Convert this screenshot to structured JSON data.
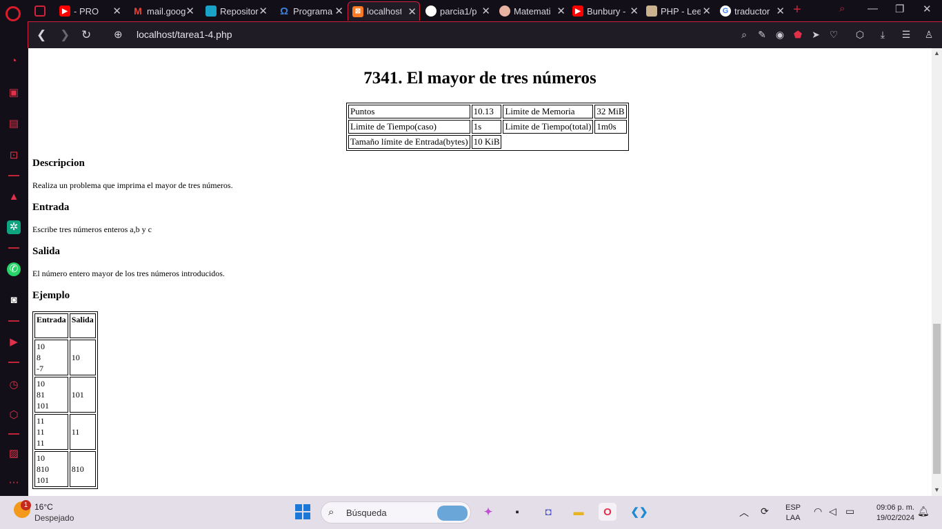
{
  "browser": {
    "tabs": [
      {
        "title": "",
        "icon": "gamepad-icon",
        "color": "#d3243c"
      },
      {
        "title": "- PRO",
        "icon": "youtube-icon",
        "color": "#ff0000"
      },
      {
        "title": "mail.goog",
        "icon": "gmail-icon",
        "color": "#ea4335"
      },
      {
        "title": "Repositor",
        "icon": "repository-icon",
        "color": "#1aa3c9"
      },
      {
        "title": "Programa",
        "icon": "omega-icon",
        "color": "#3d7fd4"
      },
      {
        "title": "localhost/",
        "icon": "xampp-icon",
        "color": "#fb7a24"
      },
      {
        "title": "parcia1/p",
        "icon": "github-icon",
        "color": "#ffffff"
      },
      {
        "title": "Matemati",
        "icon": "pig-icon",
        "color": "#e8b3a3"
      },
      {
        "title": "Bunbury -",
        "icon": "youtube-icon",
        "color": "#ff0000"
      },
      {
        "title": "PHP - Lee",
        "icon": "avatar-icon",
        "color": "#c9b28d"
      },
      {
        "title": "traductor",
        "icon": "google-icon",
        "color": "#4285f4"
      }
    ],
    "url": "localhost/tarea1-4.php"
  },
  "problem": {
    "title": "7341. El mayor de tres números",
    "info": {
      "row1": [
        "Puntos",
        "10.13",
        "Limite de Memoria",
        "32 MiB"
      ],
      "row2": [
        "Limite de Tiempo(caso)",
        "1s",
        "Limite de Tiempo(total)",
        "1m0s"
      ],
      "row3": [
        "Tamaño límite de Entrada(bytes)",
        "10 KiB"
      ]
    },
    "sections": {
      "descripcion_title": "Descripcion",
      "descripcion": "Realiza un problema que imprima el mayor de tres números.",
      "entrada_title": "Entrada",
      "entrada": "Escribe tres números enteros a,b y c",
      "salida_title": "Salida",
      "salida": "El número entero mayor de los tres números introducidos.",
      "ejemplo_title": "Ejemplo"
    },
    "example": {
      "headers": [
        "Entrada",
        "Salida"
      ],
      "rows": [
        {
          "inputs": [
            "10",
            "8",
            "-7"
          ],
          "output": "10"
        },
        {
          "inputs": [
            "10",
            "81",
            "101"
          ],
          "output": "101"
        },
        {
          "inputs": [
            "11",
            "11",
            "11"
          ],
          "output": "11"
        },
        {
          "inputs": [
            "10",
            "810",
            "101"
          ],
          "output": "810"
        }
      ]
    }
  },
  "taskbar": {
    "weather_badge": "1",
    "temperature": "16°C",
    "condition": "Despejado",
    "search_placeholder": "Búsqueda",
    "lang_top": "ESP",
    "lang_bottom": "LAA",
    "time": "09:06 p. m.",
    "date": "19/02/2024"
  }
}
